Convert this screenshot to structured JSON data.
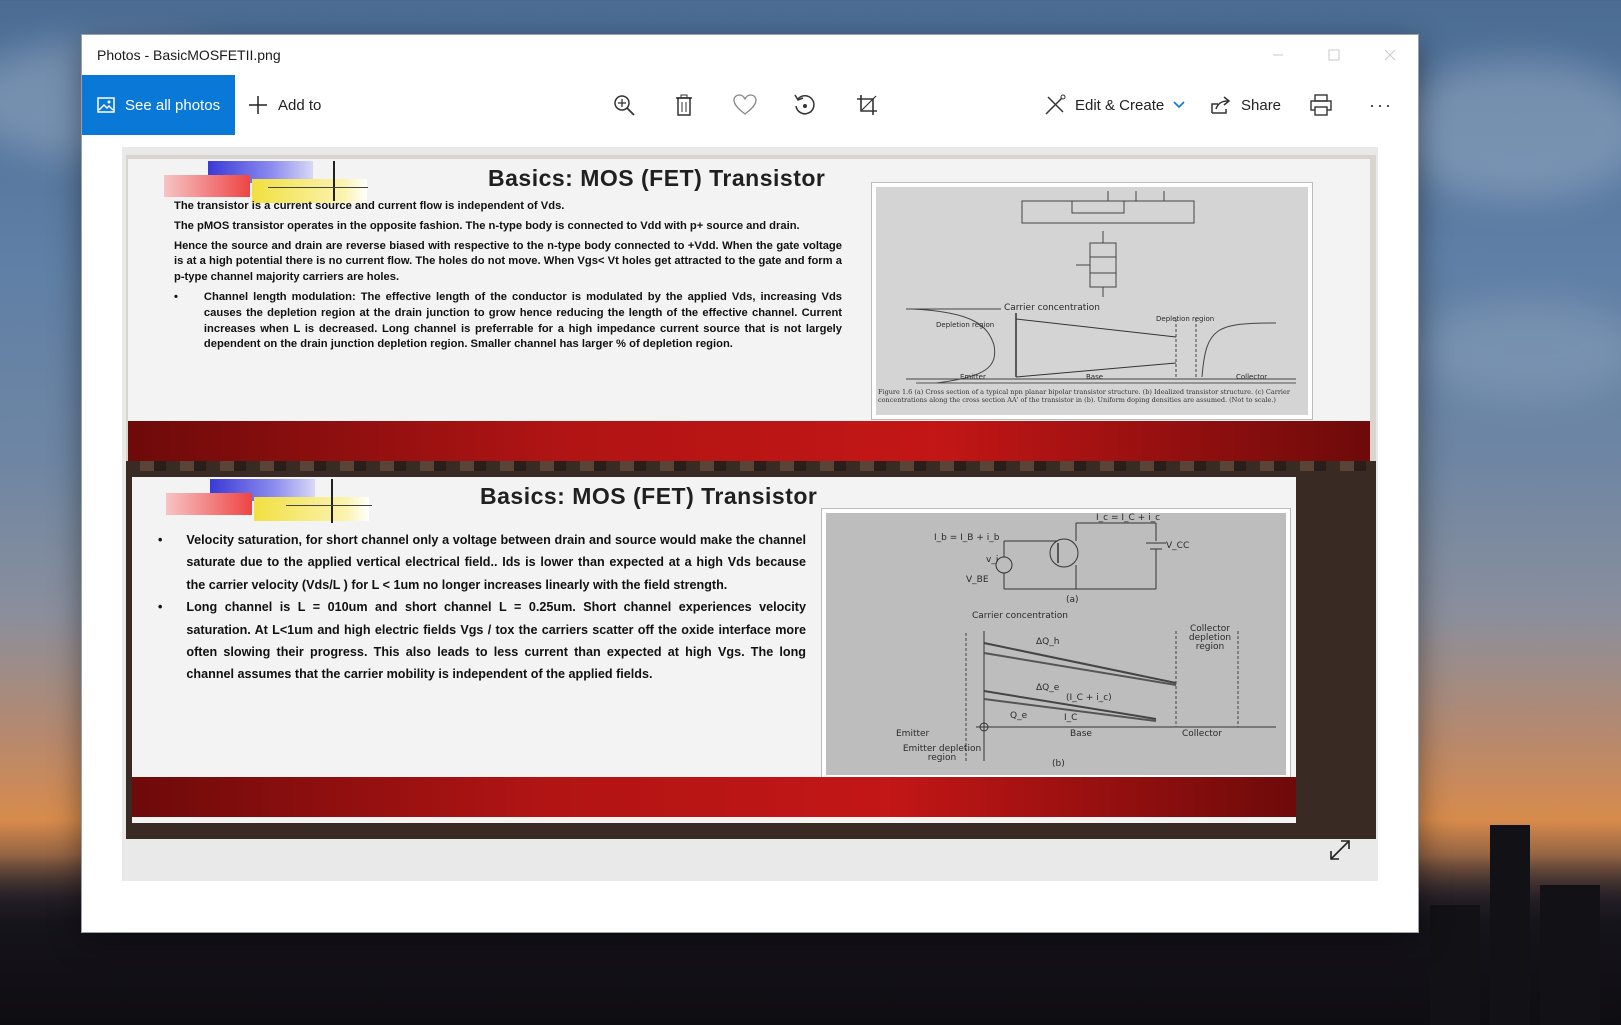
{
  "window": {
    "title": "Photos - BasicMOSFETII.png"
  },
  "toolbar": {
    "see_all_label": "See all photos",
    "add_to_label": "Add to",
    "edit_create_label": "Edit & Create",
    "share_label": "Share",
    "more_label": "···"
  },
  "slide1": {
    "title": "Basics: MOS (FET) Transistor",
    "p1": "The transistor is a current source and current flow is independent of Vds.",
    "p2": "The pMOS transistor operates in the opposite fashion. The n-type body is connected to Vdd with p+ source and drain.",
    "p3": "Hence the source and drain are reverse biased with respective to the n-type body connected to +Vdd. When the gate voltage is at a high potential there is no current flow. The holes do not move. When Vgs< Vt holes get attracted to the gate and form a p-type channel majority carriers are holes.",
    "bullet1": "Channel length modulation: The effective length of the conductor is modulated by the applied Vds, increasing Vds causes the depletion region at the drain junction to grow hence reducing the length of the effective channel. Current increases when L is decreased. Long channel is preferrable for a high impedance current source that is not largely dependent on the drain junction depletion region. Smaller channel has larger % of depletion region.",
    "fig": {
      "carrier_conc": "Carrier concentration",
      "depletion_left": "Depletion region",
      "depletion_right": "Depletion region",
      "emitter": "Emitter",
      "base": "Base",
      "collector": "Collector",
      "caption": "Figure 1.6 (a) Cross section of a typical npn planar bipolar transistor structure. (b) Idealized transistor structure. (c) Carrier concentrations along the cross section AA' of the transistor in (b). Uniform doping densities are assumed. (Not to scale.)"
    }
  },
  "slide2": {
    "title": "Basics: MOS (FET) Transistor",
    "bullet1": "Velocity saturation, for short channel only a voltage between drain and source would make the channel saturate due to the applied vertical electrical field.. Ids is lower than expected at a high Vds because the carrier velocity (Vds/L ) for L < 1um no longer increases linearly with the field strength.",
    "bullet2": "Long channel is L = 010um and short channel L = 0.25um. Short channel experiences velocity saturation. At L<1um and high electric fields Vgs / tox the carriers scatter off the oxide interface more often slowing their progress. This also leads to less current than expected at high Vgs. The long channel assumes that the carrier mobility is independent of the applied fields.",
    "fig": {
      "carrier_conc": "Carrier concentration",
      "collector_dep": "Collector depletion region",
      "emitter": "Emitter",
      "base": "Base",
      "collector": "Collector",
      "emitter_dep": "Emitter depletion region",
      "ic_label": "I_c = I_C + i_c",
      "ib_label": "I_b = I_B + i_b",
      "vcc": "V_CC",
      "vbe": "V_BE",
      "vi": "v_i",
      "a": "(a)",
      "b": "(b)",
      "dqh": "ΔQ_h",
      "dqe": "ΔQ_e",
      "qe": "Q_e",
      "ic_plus": "(I_C + i_c)",
      "icc": "I_C"
    }
  },
  "colors": {
    "accent": "#0a78d7",
    "red_band": "#c31616"
  }
}
